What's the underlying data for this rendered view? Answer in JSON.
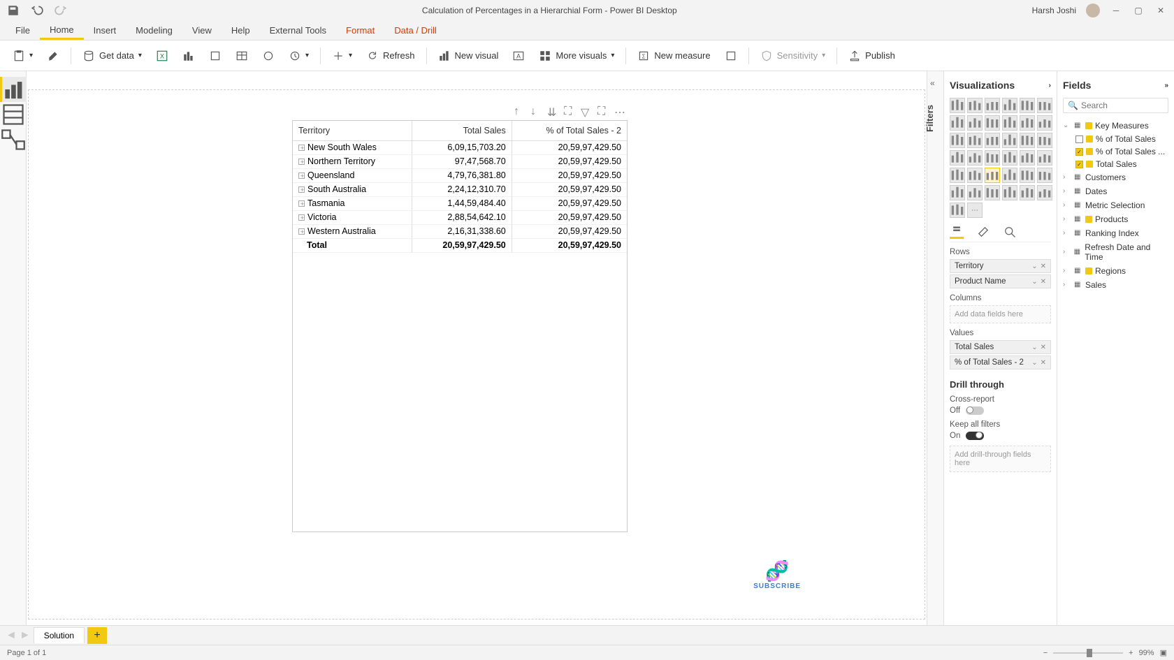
{
  "titlebar": {
    "title": "Calculation of Percentages in a Hierarchial Form - Power BI Desktop",
    "username": "Harsh Joshi"
  },
  "menu": {
    "file": "File",
    "home": "Home",
    "insert": "Insert",
    "modeling": "Modeling",
    "view": "View",
    "help": "Help",
    "external": "External Tools",
    "format": "Format",
    "data_drill": "Data / Drill"
  },
  "toolbar": {
    "get_data": "Get data",
    "refresh": "Refresh",
    "new_visual": "New visual",
    "more_visuals": "More visuals",
    "new_measure": "New measure",
    "sensitivity": "Sensitivity",
    "publish": "Publish"
  },
  "filters_label": "Filters",
  "viz": {
    "header": "Visualizations",
    "rows_label": "Rows",
    "columns_label": "Columns",
    "values_label": "Values",
    "columns_placeholder": "Add data fields here",
    "drill_header": "Drill through",
    "cross_report": "Cross-report",
    "off": "Off",
    "keep_filters": "Keep all filters",
    "on": "On",
    "drill_placeholder": "Add drill-through fields here",
    "row_fields": [
      "Territory",
      "Product Name"
    ],
    "value_fields": [
      "Total Sales",
      "% of Total Sales - 2"
    ]
  },
  "fields": {
    "header": "Fields",
    "search_placeholder": "Search",
    "tables": [
      {
        "name": "Key Measures",
        "expanded": true,
        "hot": true,
        "fields": [
          {
            "name": "% of Total Sales",
            "checked": false,
            "measure": true
          },
          {
            "name": "% of Total Sales ...",
            "checked": true,
            "measure": true
          },
          {
            "name": "Total Sales",
            "checked": true,
            "measure": true
          }
        ]
      },
      {
        "name": "Customers",
        "expanded": false
      },
      {
        "name": "Dates",
        "expanded": false
      },
      {
        "name": "Metric Selection",
        "expanded": false
      },
      {
        "name": "Products",
        "expanded": false,
        "hot": true
      },
      {
        "name": "Ranking Index",
        "expanded": false
      },
      {
        "name": "Refresh Date and Time",
        "expanded": false
      },
      {
        "name": "Regions",
        "expanded": false,
        "hot": true
      },
      {
        "name": "Sales",
        "expanded": false
      }
    ]
  },
  "matrix": {
    "headers": [
      "Territory",
      "Total Sales",
      "% of Total Sales - 2"
    ],
    "rows": [
      {
        "label": "New South Wales",
        "sales": "6,09,15,703.20",
        "pct": "20,59,97,429.50"
      },
      {
        "label": "Northern Territory",
        "sales": "97,47,568.70",
        "pct": "20,59,97,429.50"
      },
      {
        "label": "Queensland",
        "sales": "4,79,76,381.80",
        "pct": "20,59,97,429.50"
      },
      {
        "label": "South Australia",
        "sales": "2,24,12,310.70",
        "pct": "20,59,97,429.50"
      },
      {
        "label": "Tasmania",
        "sales": "1,44,59,484.40",
        "pct": "20,59,97,429.50"
      },
      {
        "label": "Victoria",
        "sales": "2,88,54,642.10",
        "pct": "20,59,97,429.50"
      },
      {
        "label": "Western Australia",
        "sales": "2,16,31,338.60",
        "pct": "20,59,97,429.50"
      }
    ],
    "total": {
      "label": "Total",
      "sales": "20,59,97,429.50",
      "pct": "20,59,97,429.50"
    }
  },
  "tabs": {
    "solution": "Solution"
  },
  "status": {
    "page": "Page 1 of 1",
    "zoom": "99%"
  },
  "subscribe": "SUBSCRIBE"
}
